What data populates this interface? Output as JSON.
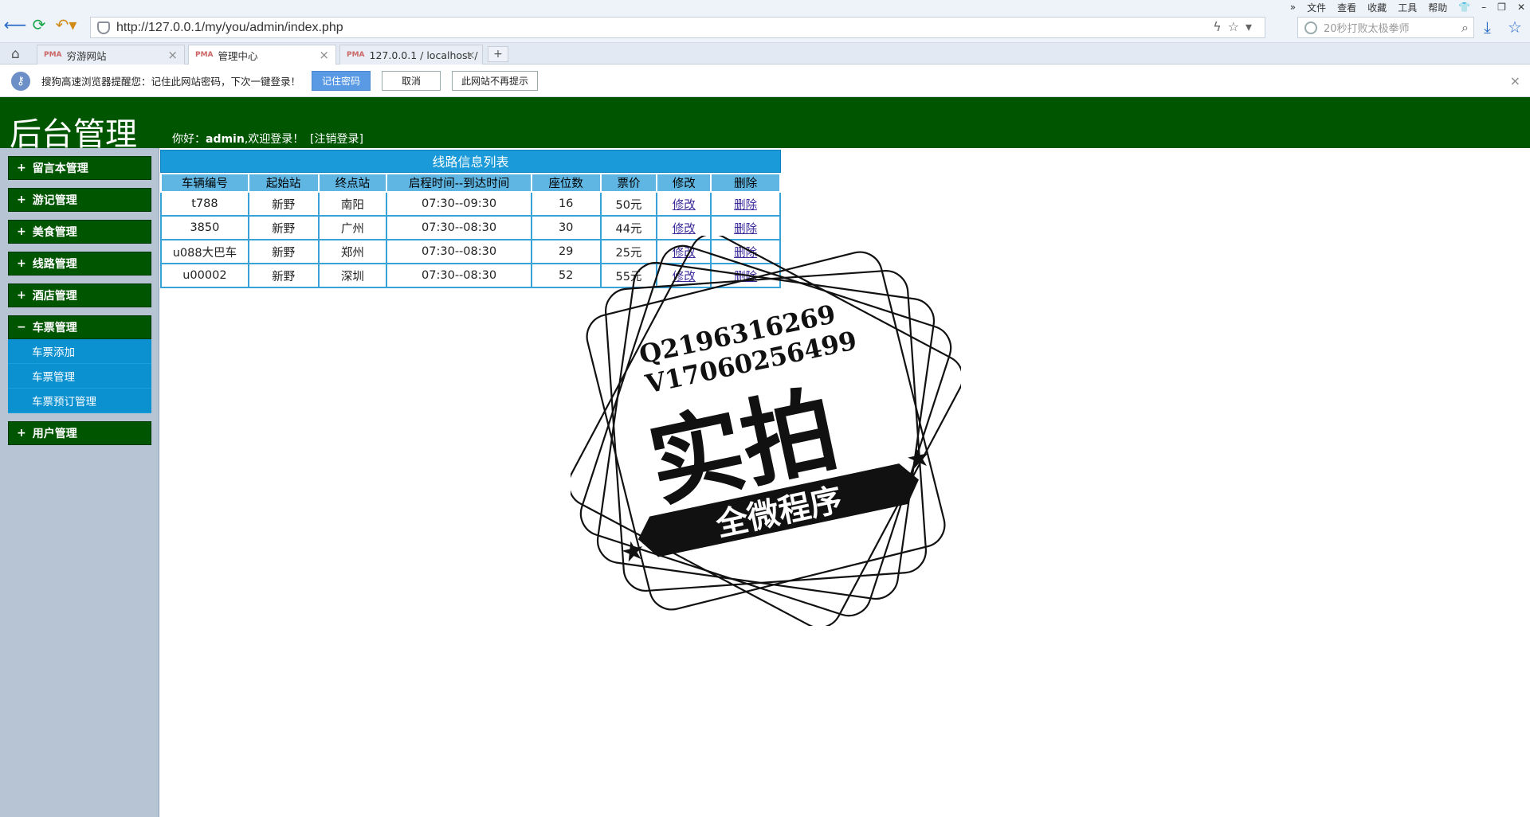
{
  "browser": {
    "url": "http://127.0.0.1/my/you/admin/index.php",
    "search_placeholder": "20秒打败太极拳师",
    "menu": [
      "文件",
      "查看",
      "收藏",
      "工具",
      "帮助"
    ],
    "tabs": [
      {
        "label": "穷游网站",
        "favicon": "PMA"
      },
      {
        "label": "管理中心",
        "favicon": "PMA"
      },
      {
        "label": "127.0.0.1 / localhost / ",
        "favicon": "PMA"
      }
    ],
    "notification": {
      "text": "搜狗高速浏览器提醒您：记住此网站密码，下次一键登录！",
      "remember_label": "记住密码",
      "cancel_label": "取消",
      "never_label": "此网站不再提示"
    }
  },
  "header": {
    "title": "后台管理",
    "greeting_prefix": "你好：",
    "username": "admin",
    "greeting_suffix": ",欢迎登录！",
    "logout_label": "[注销登录]",
    "bg_color": "#005500"
  },
  "sidebar": {
    "items": [
      {
        "sign": "+",
        "label": "留言本管理"
      },
      {
        "sign": "+",
        "label": "游记管理"
      },
      {
        "sign": "+",
        "label": "美食管理"
      },
      {
        "sign": "+",
        "label": "线路管理"
      },
      {
        "sign": "+",
        "label": "酒店管理"
      },
      {
        "sign": "−",
        "label": "车票管理"
      },
      {
        "sign": "+",
        "label": "用户管理"
      }
    ],
    "submenu": [
      "车票添加",
      "车票管理",
      "车票预订管理"
    ]
  },
  "table": {
    "caption": "线路信息列表",
    "headers": [
      "车辆编号",
      "起始站",
      "终点站",
      "启程时间--到达时间",
      "座位数",
      "票价",
      "修改",
      "删除"
    ],
    "rows": [
      {
        "id": "t788",
        "from": "新野",
        "to": "南阳",
        "time": "07:30--09:30",
        "seats": "16",
        "price": "50元",
        "edit": "修改",
        "del": "删除"
      },
      {
        "id": "3850",
        "from": "新野",
        "to": "广州",
        "time": "07:30--08:30",
        "seats": "30",
        "price": "44元",
        "edit": "修改",
        "del": "删除"
      },
      {
        "id": "u088大巴车",
        "from": "新野",
        "to": "郑州",
        "time": "07:30--08:30",
        "seats": "29",
        "price": "25元",
        "edit": "修改",
        "del": "删除"
      },
      {
        "id": "u00002",
        "from": "新野",
        "to": "深圳",
        "time": "07:30--08:30",
        "seats": "52",
        "price": "55元",
        "edit": "修改",
        "del": "删除"
      }
    ]
  },
  "watermark": {
    "line1": "Q2196316269",
    "line2": "V17060256499",
    "big": "实拍",
    "banner": "全微程序"
  }
}
